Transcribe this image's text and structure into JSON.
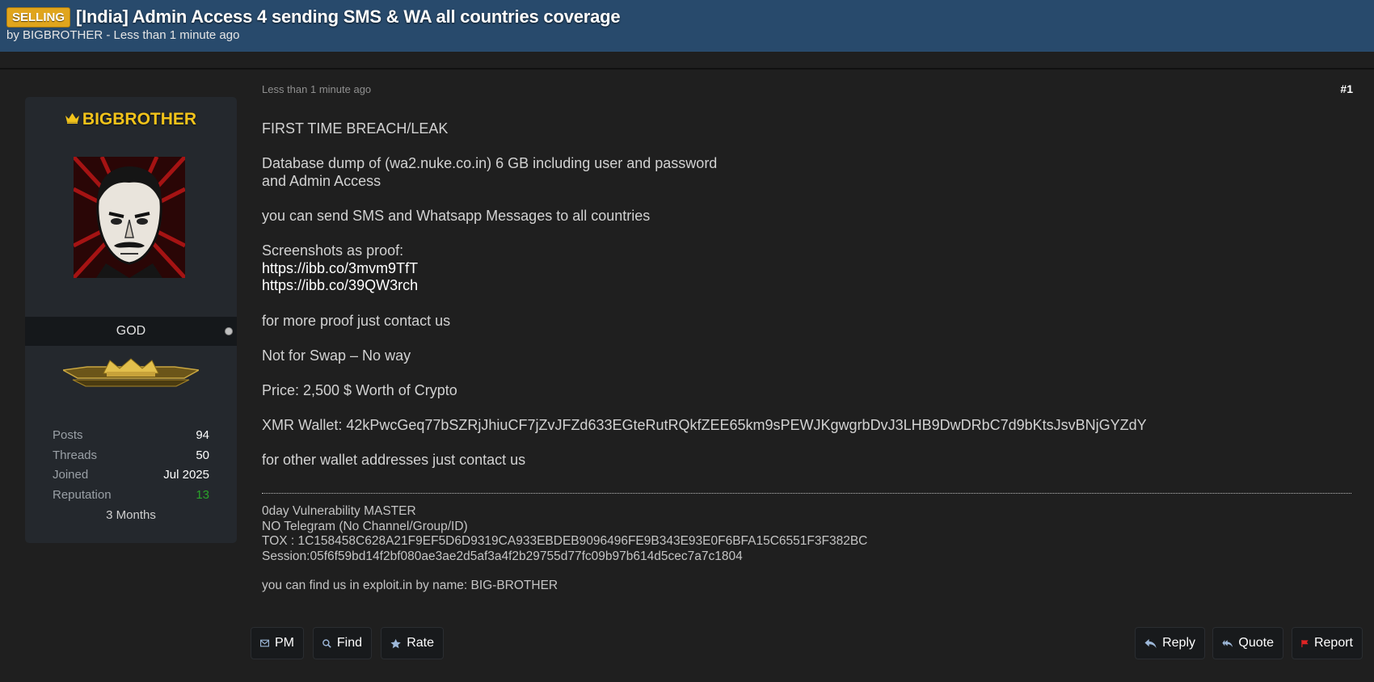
{
  "header": {
    "prefix": "SELLING",
    "title": "[India] Admin Access 4 sending SMS & WA all countries coverage",
    "byline": "by BIGBROTHER - Less than 1 minute ago"
  },
  "user": {
    "username": "BIGBROTHER",
    "username_icon": "crown-icon",
    "rank": "GOD",
    "stats": [
      {
        "label": "Posts",
        "value": "94"
      },
      {
        "label": "Threads",
        "value": "50"
      },
      {
        "label": "Joined",
        "value": "Jul 2025"
      },
      {
        "label": "Reputation",
        "value": "13"
      }
    ],
    "membership": "3 Months"
  },
  "post": {
    "date": "Less than 1 minute ago",
    "number": "#1",
    "heading": "FIRST TIME BREACH/LEAK",
    "line_db_1": "Database dump of (wa2.nuke.co.in) 6 GB including user and password",
    "line_db_2": "and Admin Access",
    "line_sms": "you can send SMS and Whatsapp Messages to all countries",
    "line_proof": "Screenshots as proof:",
    "link_1": "https://ibb.co/3mvm9TfT",
    "link_2": "https://ibb.co/39QW3rch",
    "line_contact": "for more proof just contact us",
    "line_swap": "Not for Swap – No way",
    "line_price": "Price: 2,500 $ Worth of Crypto",
    "line_xmr": "XMR Wallet: 42kPwcGeq77bSZRjJhiuCF7jZvJFZd633EGteRutRQkfZEE65km9sPEWJKgwgrbDvJ3LHB9DwDRbC7d9bKtsJsvBNjGYZdY",
    "line_wallet": "for other wallet addresses just contact us"
  },
  "signature": {
    "line_1": "0day Vulnerability MASTER",
    "line_2": "NO Telegram (No Channel/Group/ID)",
    "line_3": "TOX : 1C158458C628A21F9EF5D6D9319CA933EBDEB9096496FE9B343E93E0F6BFA15C6551F3F382BC",
    "line_4": "Session:05f6f59bd14f2bf080ae3ae2d5af3a4f2b29755d77fc09b97b614d5cec7a7c1804",
    "line_5": "you can find us in exploit.in by name: BIG-BROTHER"
  },
  "actions": {
    "pm": "PM",
    "find": "Find",
    "rate": "Rate",
    "reply": "Reply",
    "quote": "Quote",
    "report": "Report"
  },
  "colors": {
    "header_bg": "#284a6c",
    "prefix_badge": "#e0a51d",
    "username": "#f2c31a",
    "reputation": "#2aa32a",
    "report_flag": "#e02424",
    "icon_blue": "#9db8d9"
  }
}
